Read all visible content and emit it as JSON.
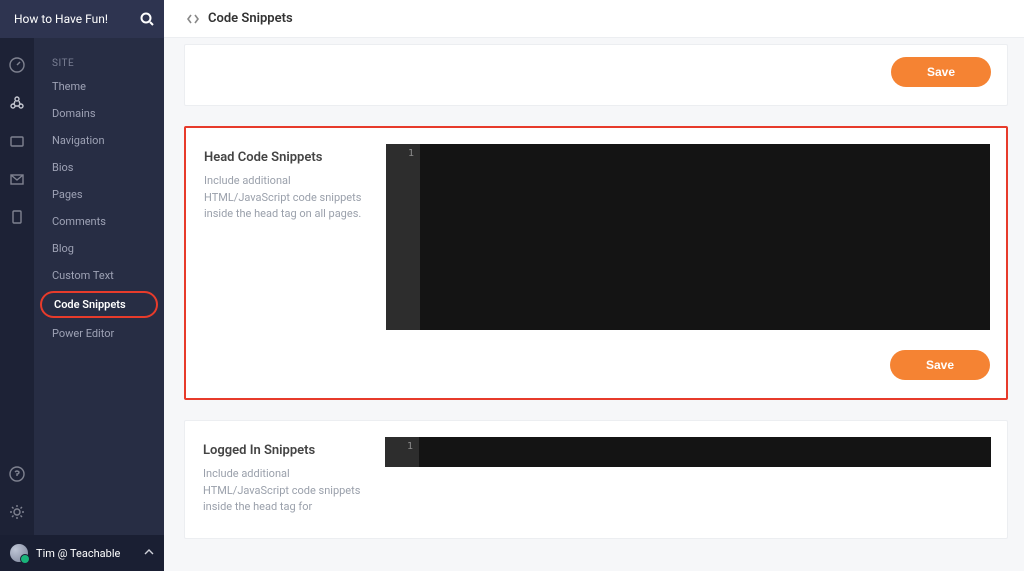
{
  "header": {
    "site_name": "How to Have Fun!"
  },
  "page": {
    "title": "Code Snippets"
  },
  "sidebar": {
    "section_label": "SITE",
    "items": [
      {
        "label": "Theme"
      },
      {
        "label": "Domains"
      },
      {
        "label": "Navigation"
      },
      {
        "label": "Bios"
      },
      {
        "label": "Pages"
      },
      {
        "label": "Comments"
      },
      {
        "label": "Blog"
      },
      {
        "label": "Custom Text"
      },
      {
        "label": "Code Snippets"
      },
      {
        "label": "Power Editor"
      }
    ],
    "active_index": 8
  },
  "user": {
    "display_name": "Tim @ Teachable"
  },
  "cards": {
    "top": {
      "save_label": "Save"
    },
    "head": {
      "title": "Head Code Snippets",
      "description": "Include additional HTML/JavaScript code snippets inside the head tag on all pages.",
      "line_label": "1",
      "save_label": "Save"
    },
    "logged_in": {
      "title": "Logged In Snippets",
      "description": "Include additional HTML/JavaScript code snippets inside the head tag for",
      "line_label": "1"
    }
  }
}
